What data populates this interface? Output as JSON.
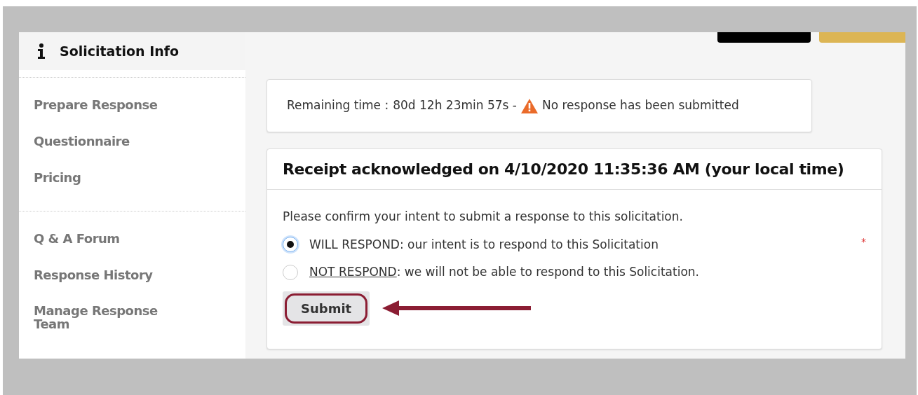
{
  "sidebar": {
    "header": {
      "label": "Solicitation Info",
      "selected": true
    },
    "groups": [
      {
        "items": [
          {
            "label": "Prepare Response"
          },
          {
            "label": "Questionnaire"
          },
          {
            "label": "Pricing"
          }
        ]
      },
      {
        "items": [
          {
            "label": "Q & A Forum"
          },
          {
            "label": "Response History"
          },
          {
            "label": "Manage Response Team"
          }
        ]
      }
    ]
  },
  "notice": {
    "label": "Remaining time :",
    "remaining": "80d 12h 23min 57s -",
    "warning": "No response has been submitted"
  },
  "receipt": {
    "title": "Receipt acknowledged on 4/10/2020 11:35:36 AM (your local time)",
    "prompt": "Please confirm your intent to submit a response to this solicitation.",
    "required_mark": "*",
    "options": [
      {
        "lead": "WILL RESPOND",
        "underlined": false,
        "text": ": our intent is to respond to this Solicitation",
        "selected": true
      },
      {
        "lead": "NOT RESPOND",
        "underlined": true,
        "text": ": we will not be able to respond to this Solicitation.",
        "selected": false
      }
    ],
    "submit": "Submit"
  }
}
